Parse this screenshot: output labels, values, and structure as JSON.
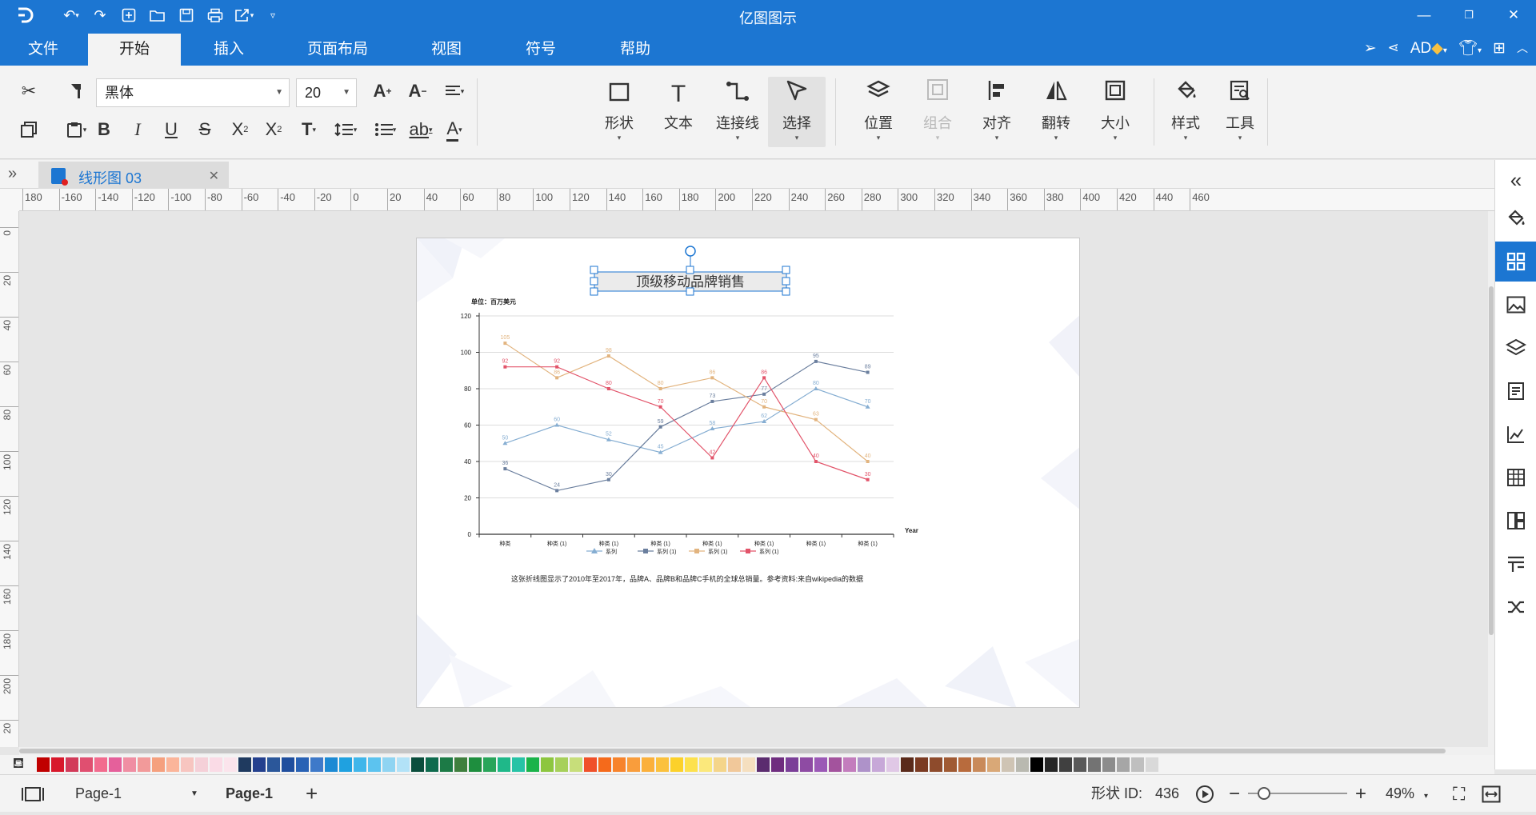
{
  "app": {
    "title": "亿图图示"
  },
  "menu": {
    "tabs": [
      "文件",
      "开始",
      "插入",
      "页面布局",
      "视图",
      "符号",
      "帮助"
    ],
    "active": "开始",
    "user": "AD"
  },
  "ribbon": {
    "font_name": "黑体",
    "font_size": "20",
    "big_buttons": [
      "形状",
      "文本",
      "连接线",
      "选择",
      "位置",
      "组合",
      "对齐",
      "翻转",
      "大小",
      "样式",
      "工具"
    ]
  },
  "doc_tab": {
    "name": "线形图 03"
  },
  "ruler": {
    "h_labels": [
      "180",
      "-160",
      "-140",
      "-120",
      "-100",
      "-80",
      "-60",
      "-40",
      "-20",
      "0",
      "20",
      "40",
      "60",
      "80",
      "100",
      "120",
      "140",
      "160",
      "180",
      "200",
      "220",
      "240",
      "260",
      "280",
      "300",
      "320",
      "340",
      "360",
      "380",
      "400",
      "420",
      "440",
      "460"
    ],
    "v_labels": [
      "0",
      "20",
      "40",
      "60",
      "80",
      "100",
      "120",
      "140",
      "160",
      "180",
      "200",
      "20"
    ]
  },
  "diagram": {
    "title": "顶级移动品牌销售",
    "caption": "这张折线图显示了2010年至2017年，品牌A、品牌B和品牌C手机的全球总销量。参考资料:来自wikipedia的数据"
  },
  "chart_data": {
    "type": "line",
    "ylabel": "单位：百万美元",
    "xlabel": "Year",
    "ylim": [
      0,
      120
    ],
    "y_ticks": [
      "0",
      "20",
      "40",
      "60",
      "80",
      "100",
      "120"
    ],
    "categories": [
      "种类",
      "种类 (1)",
      "种类 (1)",
      "种类 (1)",
      "种类 (1)",
      "种类 (1)",
      "种类 (1)",
      "种类 (1)"
    ],
    "legend": [
      "系列",
      "系列 (1)",
      "系列 (1)",
      "系列 (1)"
    ],
    "legend_position": "bottom",
    "grid": true,
    "series": [
      {
        "name": "系列",
        "color": "#86aed2",
        "marker": "triangle",
        "values": [
          50,
          60,
          52,
          45,
          58,
          62,
          80,
          70
        ]
      },
      {
        "name": "系列 (1)",
        "color": "#6b7f9e",
        "marker": "square",
        "values": [
          36,
          24,
          30,
          59,
          73,
          77,
          95,
          89
        ]
      },
      {
        "name": "系列 (1)",
        "color": "#e2b47f",
        "marker": "square",
        "values": [
          105,
          86,
          98,
          80,
          86,
          70,
          63,
          40
        ]
      },
      {
        "name": "系列 (1)",
        "color": "#e2546a",
        "marker": "square",
        "values": [
          92,
          92,
          80,
          70,
          42,
          86,
          40,
          30
        ]
      }
    ]
  },
  "status": {
    "page_selector": "Page-1",
    "page_tab": "Page-1",
    "shape_id_label": "形状 ID:",
    "shape_id": "436",
    "zoom": "49%"
  },
  "colors": {
    "brand": "#1c76d2",
    "palette": [
      "#c00000",
      "#d8182b",
      "#d23a59",
      "#e04f70",
      "#f26b8e",
      "#e5609b",
      "#f08ea3",
      "#f29a9a",
      "#f5a07e",
      "#fbb59a",
      "#f7c5c0",
      "#f5d0d8",
      "#fadbe6",
      "#fbe4ec",
      "#1f3a5f",
      "#24408e",
      "#2b579a",
      "#1f4e9e",
      "#2962b5",
      "#3e79c9",
      "#1c8ad4",
      "#1fa1e0",
      "#40b6ea",
      "#5cc3ef",
      "#8fd4f2",
      "#b2e2f7",
      "#0a4d3c",
      "#0e6b4e",
      "#1c7a46",
      "#3f7f3e",
      "#1e8e3e",
      "#29a55a",
      "#1fb889",
      "#27c3a6",
      "#1ab34a",
      "#8dc63f",
      "#a7d05a",
      "#c7de7a",
      "#f0502a",
      "#f56a1b",
      "#f7832c",
      "#f99d3c",
      "#fbb03b",
      "#fbc13d",
      "#fcd12a",
      "#fde14d",
      "#fbe87b",
      "#f4d58a",
      "#f1c89a",
      "#f5dfbf",
      "#5b2c6f",
      "#6f2d7f",
      "#7b3f98",
      "#8e4ba3",
      "#9b59b6",
      "#a3539d",
      "#c37dbd",
      "#ae92c9",
      "#c7a8d8",
      "#e0c8e6",
      "#5a2a1a",
      "#7a3a22",
      "#8e4b2c",
      "#a05a33",
      "#b86b3d",
      "#c98a5a",
      "#d9a877",
      "#cfc4b4",
      "#b9b9b0",
      "#000000",
      "#262626",
      "#404040",
      "#595959",
      "#737373",
      "#8c8c8c",
      "#a6a6a6",
      "#bfbfbf",
      "#d9d9d9"
    ]
  }
}
